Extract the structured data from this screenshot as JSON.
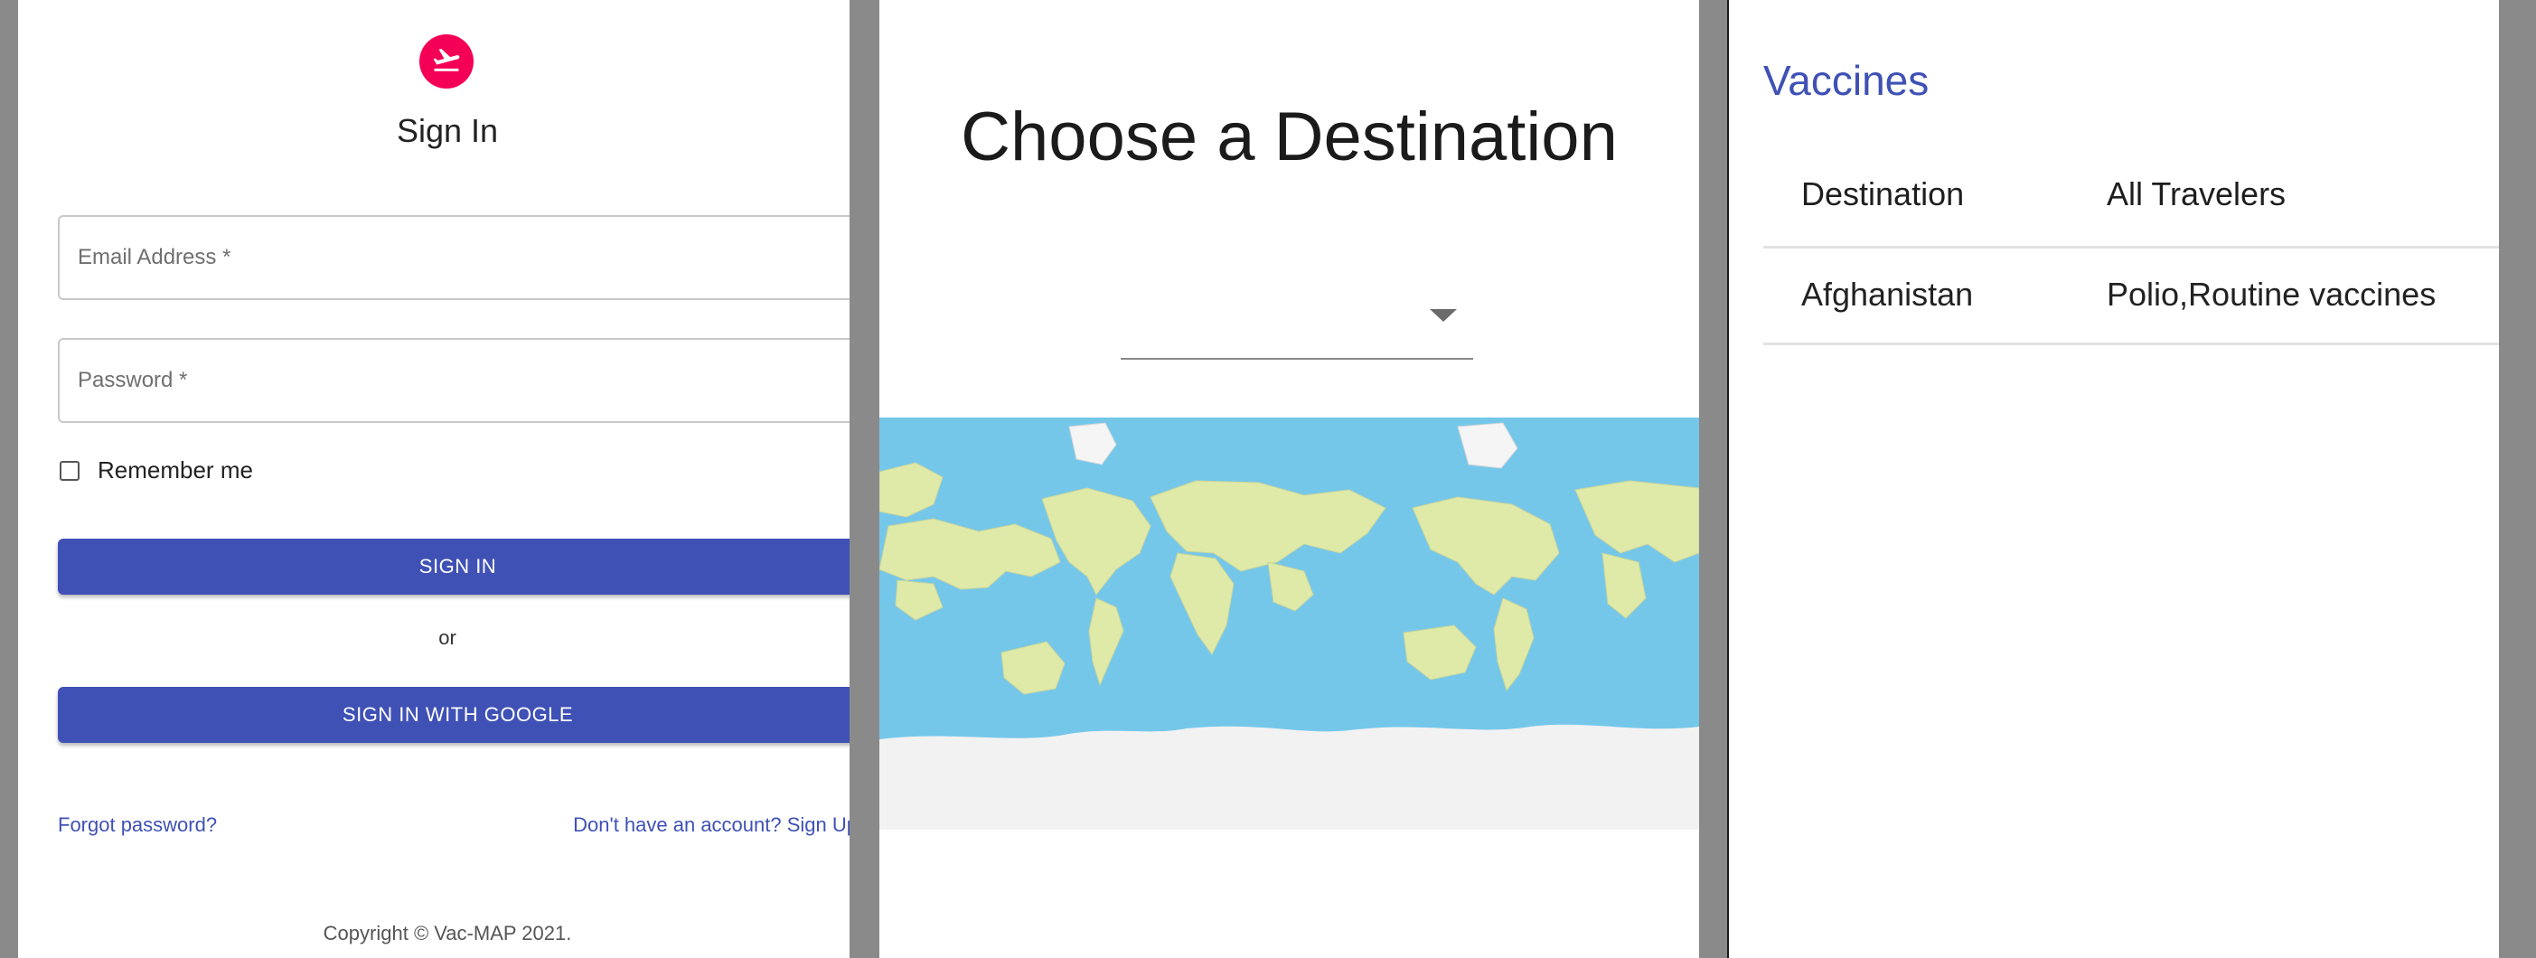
{
  "signin": {
    "brand_icon": "flight-takeoff-icon",
    "brand_color": "#f50057",
    "title": "Sign In",
    "email_placeholder": "Email Address *",
    "email_value": "",
    "password_placeholder": "Password *",
    "password_value": "",
    "remember_label": "Remember me",
    "remember_checked": false,
    "signin_button": "SIGN IN",
    "or_text": "or",
    "google_button": "SIGN IN WITH GOOGLE",
    "forgot_link": "Forgot password?",
    "signup_link": "Don't have an account? Sign Up",
    "copyright": "Copyright © Vac-MAP 2021.",
    "accent_color": "#3f51b5"
  },
  "destination": {
    "title": "Choose a Destination",
    "select_value": "",
    "map_water_color": "#75c7ea",
    "map_land_color": "#dfeaa9"
  },
  "vaccines": {
    "title": "Vaccines",
    "columns": [
      "Destination",
      "All Travelers"
    ],
    "rows": [
      [
        "Afghanistan",
        "Polio,Routine vaccines"
      ]
    ]
  }
}
